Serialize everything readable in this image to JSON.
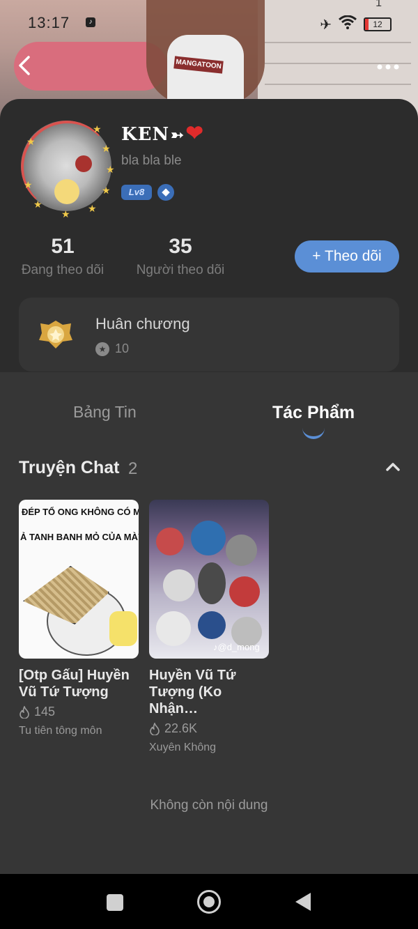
{
  "status_bar": {
    "time": "13:17",
    "battery": "12",
    "notification_count": "1"
  },
  "hero": {
    "shirt_text": "MANGATOON"
  },
  "profile": {
    "name": "KEN",
    "name_arrow": "➳",
    "name_heart": "❤",
    "bio": "bla bla ble",
    "level": "Lv8"
  },
  "stats": {
    "following_count": "51",
    "following_label": "Đang theo dõi",
    "followers_count": "35",
    "followers_label": "Người theo dõi"
  },
  "follow_button": {
    "icon": "+",
    "label": "Theo dõi"
  },
  "medal": {
    "title": "Huân chương",
    "count": "10"
  },
  "tabs": [
    {
      "label": "Bảng Tin",
      "active": false
    },
    {
      "label": "Tác Phẩm",
      "active": true
    }
  ],
  "section": {
    "title": "Truyện Chat",
    "count": "2"
  },
  "stories": [
    {
      "title": "[Otp Gấu] Huyền Vũ Tứ Tượng",
      "views": "145",
      "genre": "Tu tiên tông môn",
      "cover_text_1": "ĐÉP TỔ ONG KHÔNG CÓ MẮT",
      "cover_text_2": "Ả TANH BANH MỎ CỦA MÀY"
    },
    {
      "title": "Huyền Vũ Tứ Tượng (Ko Nhận…",
      "views": "22.6K",
      "genre": "Xuyên Không",
      "cover_tag": "♪@d_mong"
    }
  ],
  "footer": {
    "no_more": "Không còn nội dung"
  },
  "colors": {
    "accent": "#5b8fd6",
    "background": "#363636",
    "card": "#2c2c2c",
    "heart": "#e02b2b"
  }
}
